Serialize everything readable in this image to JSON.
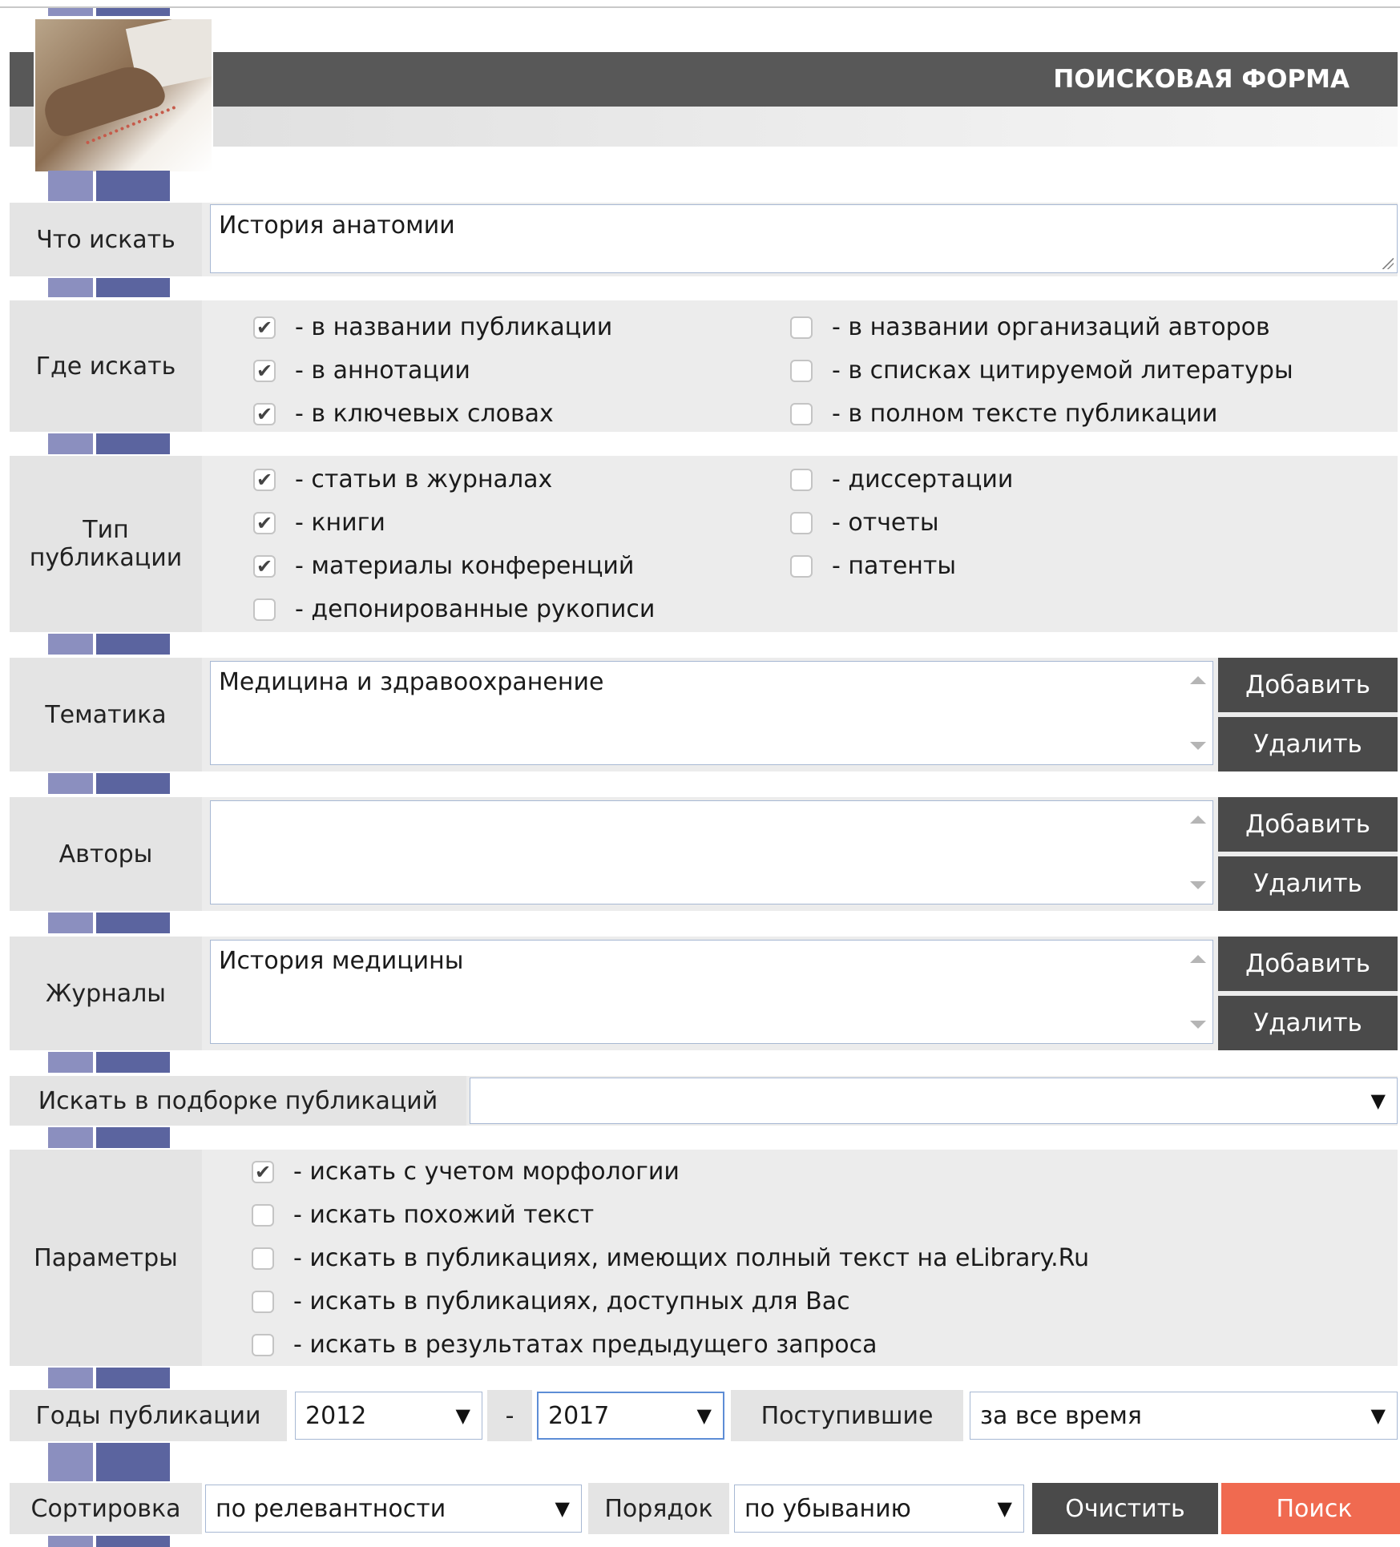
{
  "header": {
    "title": "ПОИСКОВАЯ ФОРМА"
  },
  "query": {
    "label": "Что искать",
    "value": "История анатомии"
  },
  "where": {
    "label": "Где искать",
    "options": [
      {
        "text": "- в названии публикации",
        "checked": true
      },
      {
        "text": "- в аннотации",
        "checked": true
      },
      {
        "text": "- в ключевых словах",
        "checked": true
      },
      {
        "text": "- в названии организаций авторов",
        "checked": false
      },
      {
        "text": "- в списках цитируемой литературы",
        "checked": false
      },
      {
        "text": "- в полном тексте публикации",
        "checked": false
      }
    ]
  },
  "pubtype": {
    "label": "Тип публикации",
    "options": [
      {
        "text": "- статьи в журналах",
        "checked": true
      },
      {
        "text": "- книги",
        "checked": true
      },
      {
        "text": "- материалы конференций",
        "checked": true
      },
      {
        "text": "- депонированные рукописи",
        "checked": false
      },
      {
        "text": "- диссертации",
        "checked": false
      },
      {
        "text": "- отчеты",
        "checked": false
      },
      {
        "text": "- патенты",
        "checked": false
      }
    ]
  },
  "topic": {
    "label": "Тематика",
    "value": "Медицина и здравоохранение",
    "add": "Добавить",
    "remove": "Удалить"
  },
  "authors": {
    "label": "Авторы",
    "value": "",
    "add": "Добавить",
    "remove": "Удалить"
  },
  "journals": {
    "label": "Журналы",
    "value": "История медицины",
    "add": "Добавить",
    "remove": "Удалить"
  },
  "collection": {
    "label": "Искать в подборке публикаций",
    "value": ""
  },
  "params": {
    "label": "Параметры",
    "options": [
      {
        "text": "- искать с учетом морфологии",
        "checked": true
      },
      {
        "text": "- искать похожий текст",
        "checked": false
      },
      {
        "text": "- искать в публикациях, имеющих полный текст на eLibrary.Ru",
        "checked": false
      },
      {
        "text": "- искать в публикациях, доступных для Вас",
        "checked": false
      },
      {
        "text": "- искать в результатах предыдущего запроса",
        "checked": false
      }
    ]
  },
  "years": {
    "label": "Годы публикации",
    "from": "2012",
    "dash": "-",
    "to": "2017",
    "received_label": "Поступившие",
    "received_value": "за все время"
  },
  "sorting": {
    "label": "Сортировка",
    "value": "по релевантности",
    "order_label": "Порядок",
    "order_value": "по убыванию",
    "clear": "Очистить",
    "search": "Поиск"
  },
  "colors": {
    "header": "#585858",
    "button_dark": "#4a4a4a",
    "button_search": "#f06a50",
    "spacer_light": "#8b8fbf",
    "spacer_dark": "#5b649f"
  },
  "icons": {
    "check": "checkmark-icon",
    "dropdown": "dropdown-arrow-icon"
  }
}
